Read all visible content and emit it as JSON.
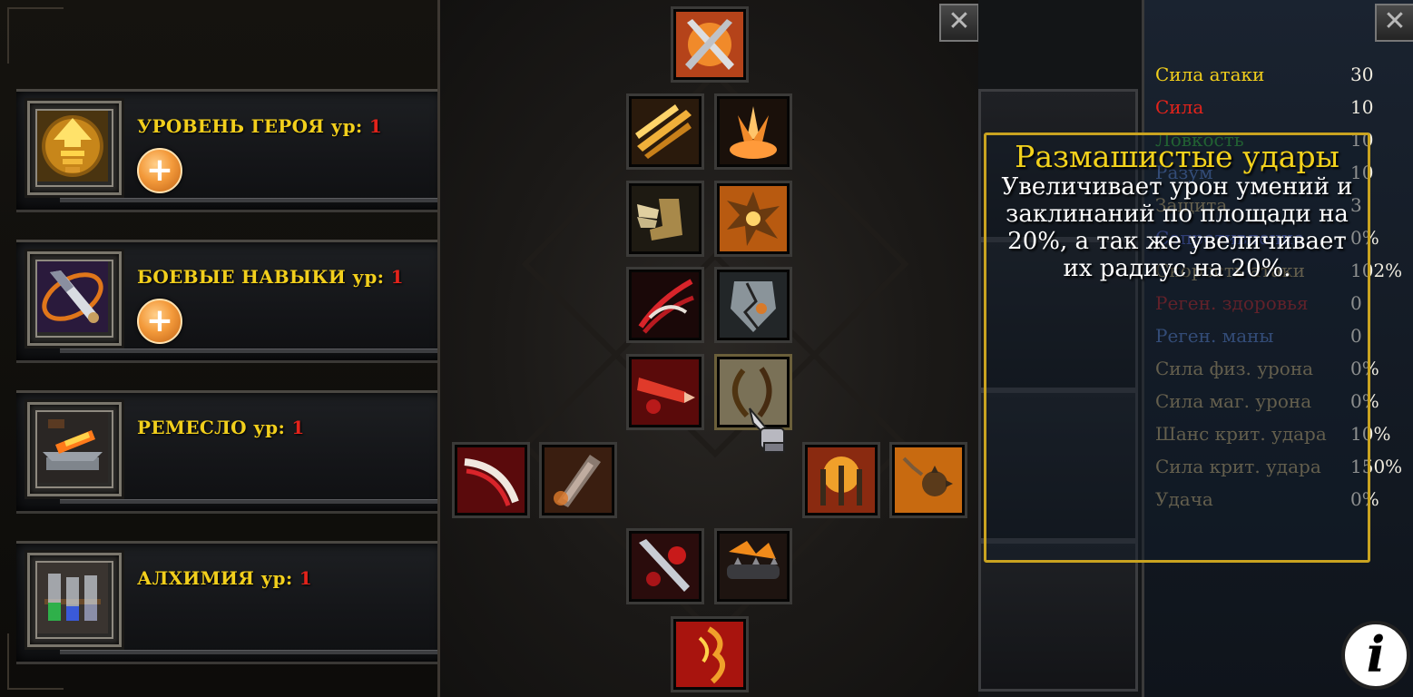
{
  "left_panel": {
    "skills": [
      {
        "name": "УРОВЕНЬ ГЕРОЯ",
        "lvl_label": "ур:",
        "lvl": "1",
        "icon": "hero-level-arrow-icon",
        "has_plus": true
      },
      {
        "name": "БОЕВЫЕ НАВЫКИ",
        "lvl_label": "ур:",
        "lvl": "1",
        "icon": "combat-skills-sword-icon",
        "has_plus": true
      },
      {
        "name": "РЕМЕСЛО",
        "lvl_label": "ур:",
        "lvl": "1",
        "icon": "crafting-anvil-icon",
        "has_plus": false
      },
      {
        "name": "АЛХИМИЯ",
        "lvl_label": "ур:",
        "lvl": "1",
        "icon": "alchemy-flasks-icon",
        "has_plus": false
      }
    ],
    "plus_label": "+"
  },
  "skill_tree": {
    "close_label": "✕",
    "nodes": [
      {
        "icon": "crossed-swords-icon"
      },
      {
        "icon": "flying-blades-icon"
      },
      {
        "icon": "fire-burst-icon"
      },
      {
        "icon": "winged-boot-icon"
      },
      {
        "icon": "spiked-explosion-icon"
      },
      {
        "icon": "bloody-claw-icon"
      },
      {
        "icon": "cracked-armor-icon"
      },
      {
        "icon": "bleeding-strike-icon"
      },
      {
        "icon": "sweeping-strikes-icon",
        "selected": true
      },
      {
        "icon": "blood-slash-icon"
      },
      {
        "icon": "heavy-blade-icon"
      },
      {
        "icon": "triple-daggers-icon"
      },
      {
        "icon": "flaming-mace-icon"
      },
      {
        "icon": "bleeding-sword-icon"
      },
      {
        "icon": "flaming-spiked-club-icon"
      },
      {
        "icon": "rage-face-icon"
      }
    ]
  },
  "stats": {
    "close_label": "✕",
    "rows": [
      {
        "name": "Сила атаки",
        "value": "30",
        "color": "#f2cf1c"
      },
      {
        "name": "Сила",
        "value": "10",
        "color": "#e3231b"
      },
      {
        "name": "Ловкость",
        "value": "10",
        "color": "#2f9a3a"
      },
      {
        "name": "Разум",
        "value": "10",
        "color": "#4f74b8"
      },
      {
        "name": "Защита",
        "value": "3",
        "color": "#a8956a"
      },
      {
        "name": "Сопротивление",
        "value": "0%",
        "color": "#4a5ab8"
      },
      {
        "name": "Скорость атаки",
        "value": "102%",
        "color": "#a8956a"
      },
      {
        "name": "Реген. здоровья",
        "value": "0",
        "color": "#a3262a"
      },
      {
        "name": "Реген. маны",
        "value": "0",
        "color": "#4f74b8"
      },
      {
        "name": "Сила физ. урона",
        "value": "0%",
        "color": "#a8956a"
      },
      {
        "name": "Сила маг. урона",
        "value": "0%",
        "color": "#a8956a"
      },
      {
        "name": "Шанс крит. удара",
        "value": "10%",
        "color": "#a8956a"
      },
      {
        "name": "Сила крит. удара",
        "value": "150%",
        "color": "#a8956a"
      },
      {
        "name": "Удача",
        "value": "0%",
        "color": "#a8956a"
      }
    ]
  },
  "tooltip": {
    "title": "Размашистые удары",
    "description": "Увеличивает урон умений и заклинаний по площади на 20%, а так же увеличивает их радиус на 20%."
  },
  "info_button": {
    "label": "i"
  }
}
